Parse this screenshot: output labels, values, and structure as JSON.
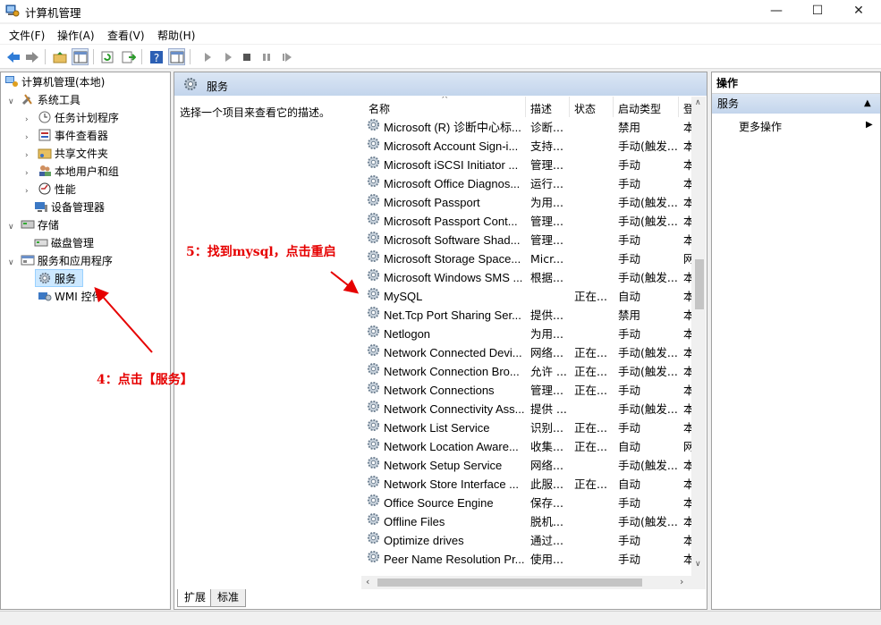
{
  "window": {
    "title": "计算机管理",
    "minimize_glyph": "—",
    "maximize_glyph": "☐",
    "close_glyph": "✕"
  },
  "menu": [
    "文件(F)",
    "操作(A)",
    "查看(V)",
    "帮助(H)"
  ],
  "tree": {
    "root": "计算机管理(本地)",
    "system_tools": "系统工具",
    "task_scheduler": "任务计划程序",
    "event_viewer": "事件查看器",
    "shared_folders": "共享文件夹",
    "local_users": "本地用户和组",
    "performance": "性能",
    "device_manager": "设备管理器",
    "storage": "存储",
    "disk_management": "磁盘管理",
    "services_apps": "服务和应用程序",
    "services": "服务",
    "wmi": "WMI 控件"
  },
  "mid": {
    "header_title": "服务",
    "description": "选择一个项目来查看它的描述。",
    "tabs": [
      "扩展",
      "标准"
    ]
  },
  "columns": {
    "name": "名称",
    "desc": "描述",
    "status": "状态",
    "startup": "启动类型",
    "logon": "登"
  },
  "services": [
    {
      "name": "Microsoft (R) 诊断中心标...",
      "desc": "诊断...",
      "status": "",
      "startup": "禁用",
      "logon": "本"
    },
    {
      "name": "Microsoft Account Sign-i...",
      "desc": "支持...",
      "status": "",
      "startup": "手动(触发...",
      "logon": "本"
    },
    {
      "name": "Microsoft iSCSI Initiator ...",
      "desc": "管理...",
      "status": "",
      "startup": "手动",
      "logon": "本"
    },
    {
      "name": "Microsoft Office Diagnos...",
      "desc": "运行...",
      "status": "",
      "startup": "手动",
      "logon": "本"
    },
    {
      "name": "Microsoft Passport",
      "desc": "为用...",
      "status": "",
      "startup": "手动(触发...",
      "logon": "本"
    },
    {
      "name": "Microsoft Passport Cont...",
      "desc": "管理...",
      "status": "",
      "startup": "手动(触发...",
      "logon": "本"
    },
    {
      "name": "Microsoft Software Shad...",
      "desc": "管理...",
      "status": "",
      "startup": "手动",
      "logon": "本"
    },
    {
      "name": "Microsoft Storage Space...",
      "desc": "Micr...",
      "status": "",
      "startup": "手动",
      "logon": "网"
    },
    {
      "name": "Microsoft Windows SMS ...",
      "desc": "根据...",
      "status": "",
      "startup": "手动(触发...",
      "logon": "本"
    },
    {
      "name": "MySQL",
      "desc": "",
      "status": "正在...",
      "startup": "自动",
      "logon": "本"
    },
    {
      "name": "Net.Tcp Port Sharing Ser...",
      "desc": "提供...",
      "status": "",
      "startup": "禁用",
      "logon": "本"
    },
    {
      "name": "Netlogon",
      "desc": "为用...",
      "status": "",
      "startup": "手动",
      "logon": "本"
    },
    {
      "name": "Network Connected Devi...",
      "desc": "网络...",
      "status": "正在...",
      "startup": "手动(触发...",
      "logon": "本"
    },
    {
      "name": "Network Connection Bro...",
      "desc": "允许 ...",
      "status": "正在...",
      "startup": "手动(触发...",
      "logon": "本"
    },
    {
      "name": "Network Connections",
      "desc": "管理...",
      "status": "正在...",
      "startup": "手动",
      "logon": "本"
    },
    {
      "name": "Network Connectivity Ass...",
      "desc": "提供 ...",
      "status": "",
      "startup": "手动(触发...",
      "logon": "本"
    },
    {
      "name": "Network List Service",
      "desc": "识别...",
      "status": "正在...",
      "startup": "手动",
      "logon": "本"
    },
    {
      "name": "Network Location Aware...",
      "desc": "收集...",
      "status": "正在...",
      "startup": "自动",
      "logon": "网"
    },
    {
      "name": "Network Setup Service",
      "desc": "网络...",
      "status": "",
      "startup": "手动(触发...",
      "logon": "本"
    },
    {
      "name": "Network Store Interface ...",
      "desc": "此服...",
      "status": "正在...",
      "startup": "自动",
      "logon": "本"
    },
    {
      "name": "Office Source Engine",
      "desc": "保存...",
      "status": "",
      "startup": "手动",
      "logon": "本"
    },
    {
      "name": "Offline Files",
      "desc": "脱机...",
      "status": "",
      "startup": "手动(触发...",
      "logon": "本"
    },
    {
      "name": "Optimize drives",
      "desc": "通过...",
      "status": "",
      "startup": "手动",
      "logon": "本"
    },
    {
      "name": "Peer Name Resolution Pr...",
      "desc": "使用...",
      "status": "",
      "startup": "手动",
      "logon": "本"
    }
  ],
  "actions": {
    "title": "操作",
    "section": "服务",
    "more": "更多操作"
  },
  "annotations": {
    "step4": "4：点击【服务】",
    "step5": "5：找到mysql，点击重启"
  },
  "colors": {
    "annotation": "#e60000",
    "selection": "#cce8ff",
    "header_gradient": "#c3d5ec"
  }
}
